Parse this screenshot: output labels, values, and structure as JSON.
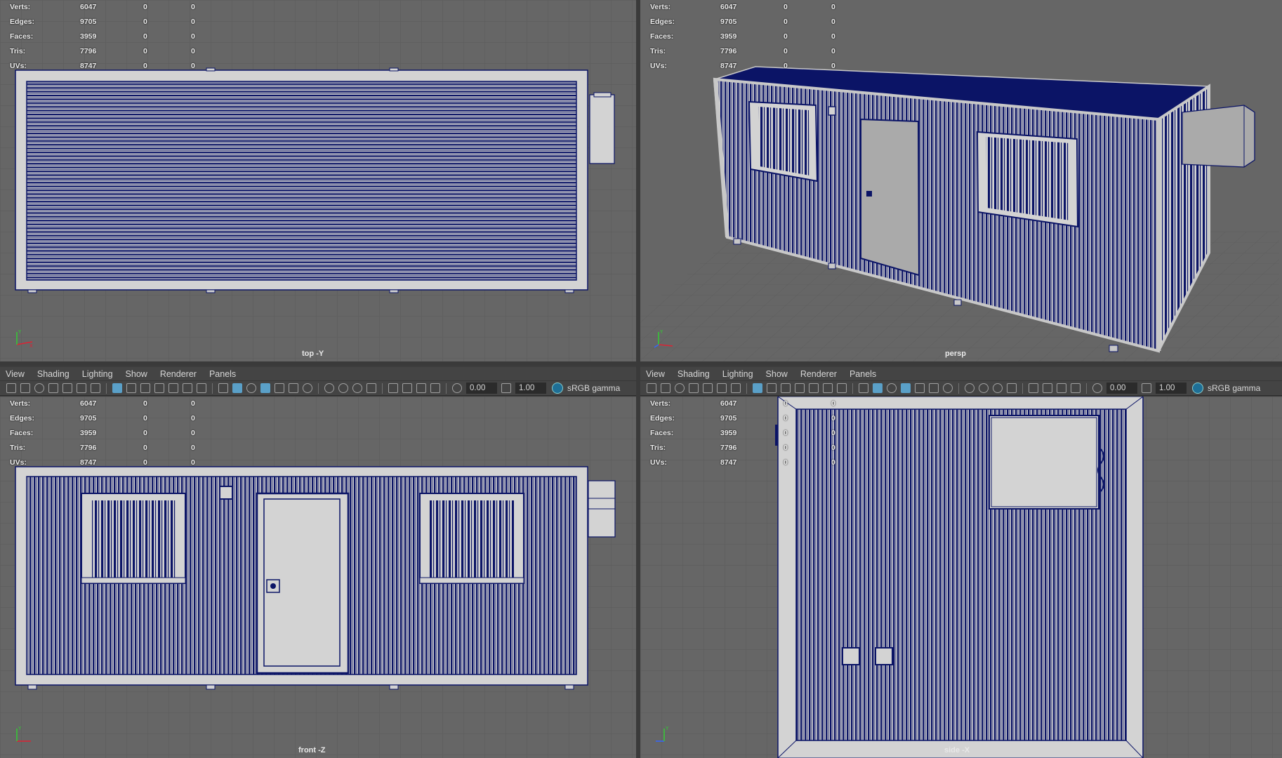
{
  "hud": [
    {
      "label": "Verts:",
      "v1": "6047",
      "v2": "0",
      "v3": "0"
    },
    {
      "label": "Edges:",
      "v1": "9705",
      "v2": "0",
      "v3": "0"
    },
    {
      "label": "Faces:",
      "v1": "3959",
      "v2": "0",
      "v3": "0"
    },
    {
      "label": "Tris:",
      "v1": "7796",
      "v2": "0",
      "v3": "0"
    },
    {
      "label": "UVs:",
      "v1": "8747",
      "v2": "0",
      "v3": "0"
    }
  ],
  "viewports": {
    "top": {
      "label": "top -Y"
    },
    "persp": {
      "label": "persp"
    },
    "front": {
      "label": "front -Z"
    },
    "side": {
      "label": "side -X"
    }
  },
  "menu": [
    "View",
    "Shading",
    "Lighting",
    "Show",
    "Renderer",
    "Panels"
  ],
  "toolbar": {
    "exposure": "0.00",
    "gamma": "1.00",
    "color_space": "sRGB gamma"
  },
  "colors": {
    "wire": "#0b1466",
    "face": "#d3d3d3",
    "viewport_bg": "#666666",
    "grid": "#5b5b5b",
    "ui_bg": "#444444"
  }
}
